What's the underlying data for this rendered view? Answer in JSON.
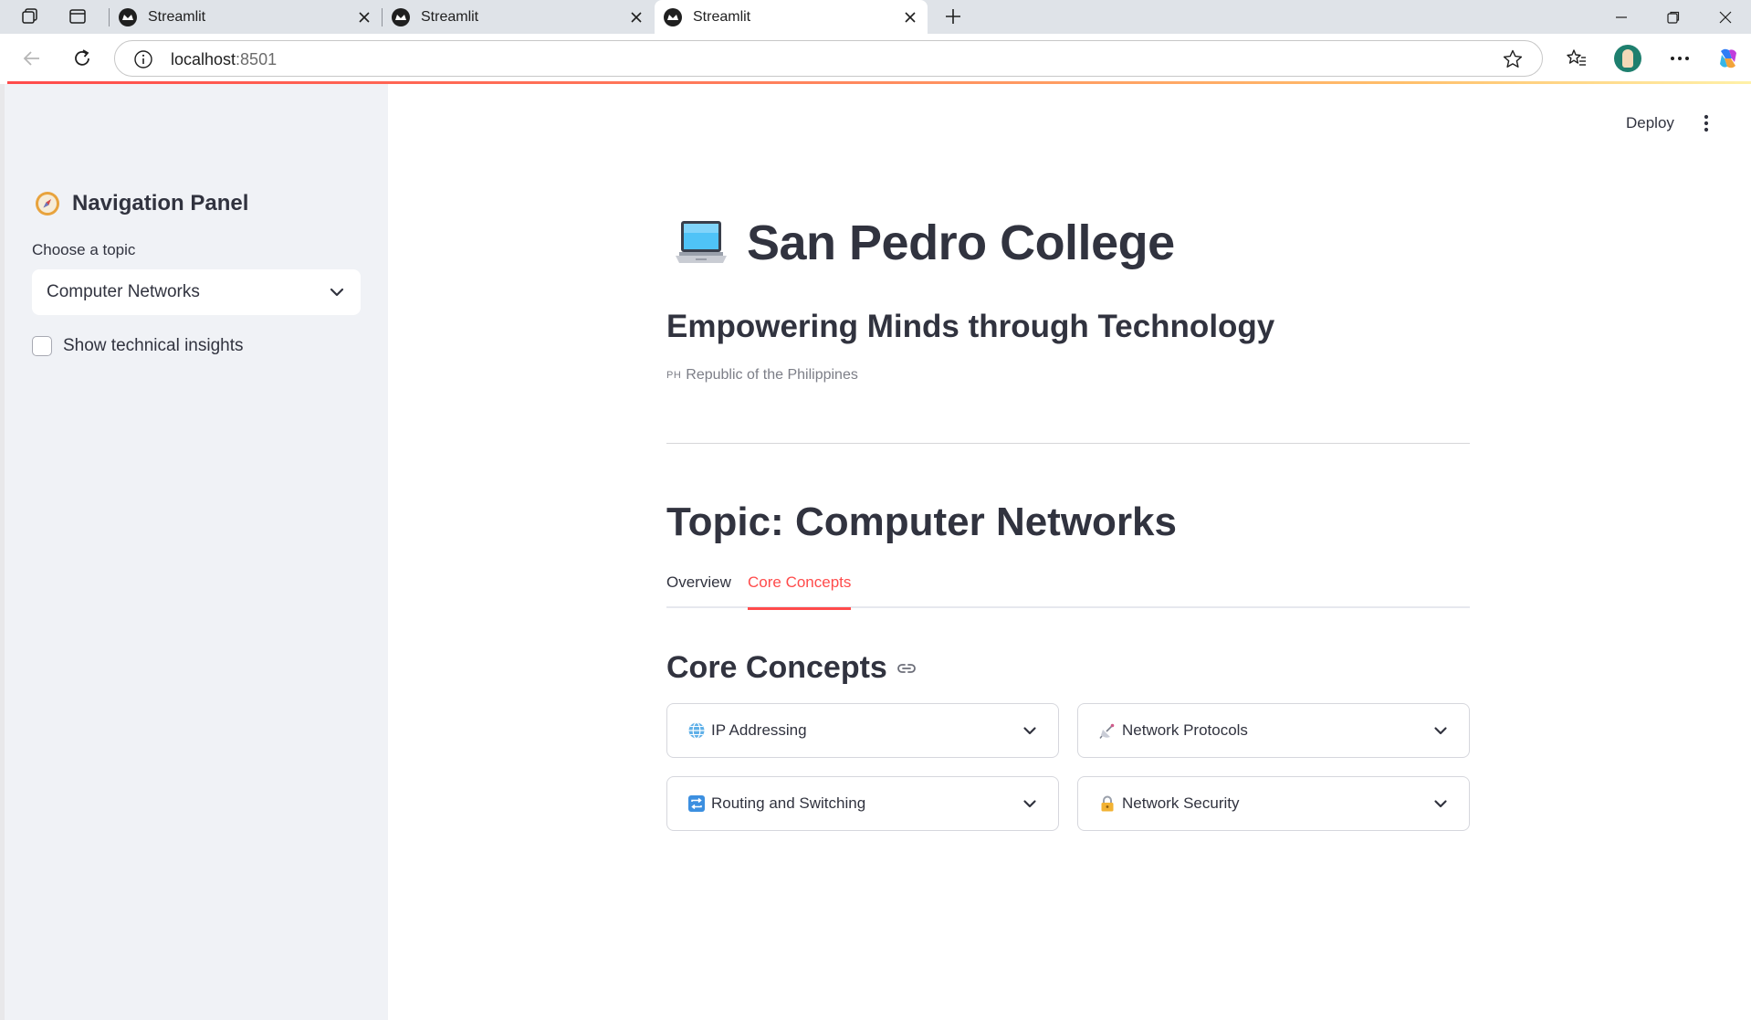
{
  "browser": {
    "tabs": [
      {
        "title": "Streamlit",
        "active": false
      },
      {
        "title": "Streamlit",
        "active": false
      },
      {
        "title": "Streamlit",
        "active": true
      }
    ],
    "url_host": "localhost",
    "url_port": ":8501"
  },
  "header": {
    "deploy_label": "Deploy"
  },
  "sidebar": {
    "title": "Navigation Panel",
    "select_label": "Choose a topic",
    "select_value": "Computer Networks",
    "checkbox_label": "Show technical insights",
    "checkbox_checked": false
  },
  "main": {
    "title": "San Pedro College",
    "subtitle": "Empowering Minds through Technology",
    "country_flag": "PH",
    "country_text": "Republic of the Philippines",
    "topic_title": "Topic: Computer Networks",
    "tabs": [
      {
        "label": "Overview",
        "active": false
      },
      {
        "label": "Core Concepts",
        "active": true
      }
    ],
    "section_title": "Core Concepts",
    "expanders": [
      {
        "label": "IP Addressing",
        "icon": "globe-icon"
      },
      {
        "label": "Network Protocols",
        "icon": "satellite-icon"
      },
      {
        "label": "Routing and Switching",
        "icon": "repeat-icon"
      },
      {
        "label": "Network Security",
        "icon": "lock-icon"
      }
    ]
  },
  "colors": {
    "accent": "#ff4b4b",
    "sidebar_bg": "#f0f2f6",
    "text": "#31333f"
  }
}
